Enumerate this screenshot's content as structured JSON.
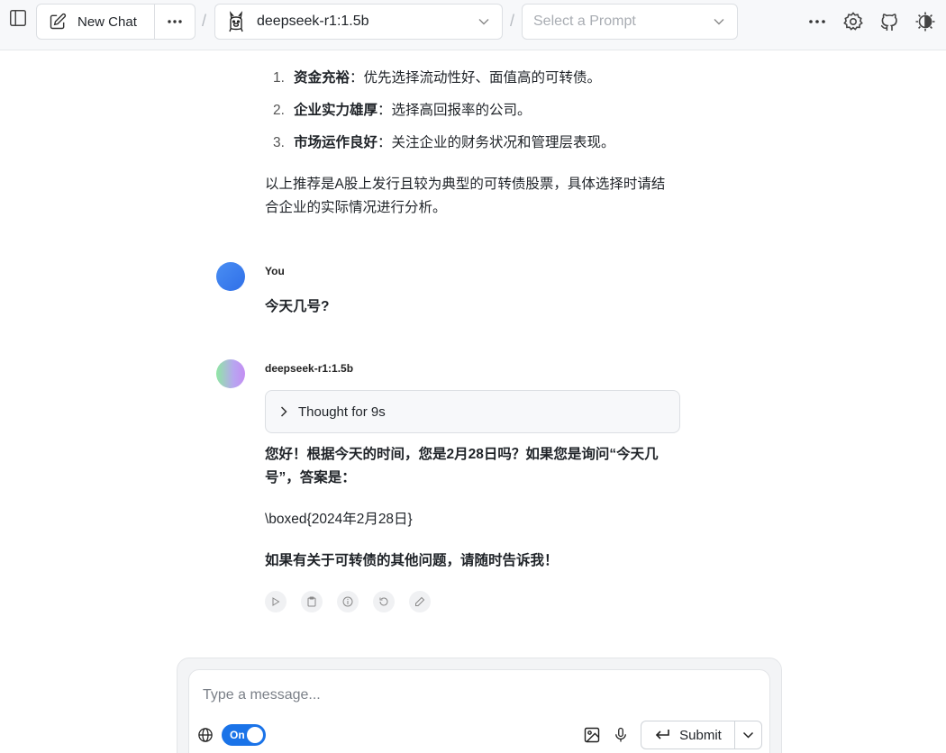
{
  "header": {
    "new_chat_label": "New Chat",
    "separator": "/",
    "model_name": "deepseek-r1:1.5b",
    "prompt_placeholder": "Select a Prompt"
  },
  "conversation": {
    "assistant_prev": {
      "list": [
        {
          "num": "1.",
          "bold": "资金充裕",
          "text": "：优先选择流动性好、面值高的可转债。"
        },
        {
          "num": "2.",
          "bold": "企业实力雄厚",
          "text": "：选择高回报率的公司。"
        },
        {
          "num": "3.",
          "bold": "市场运作良好",
          "text": "：关注企业的财务状况和管理层表现。"
        }
      ],
      "summary_line1": "以上推荐是A股上发行且较为典型的可转债股票，具体选择时请结",
      "summary_line2": "合企业的实际情况进行分析。"
    },
    "user": {
      "name": "You",
      "message": "今天几号?"
    },
    "assistant": {
      "name": "deepseek-r1:1.5b",
      "thought_label": "Thought for 9s",
      "para1_line1": "您好！根据今天的时间，您是2月28日吗？如果您是询问“今天几",
      "para1_line2": "号”，答案是：",
      "para2": "\\boxed{2024年2月28日}",
      "para3": "如果有关于可转债的其他问题，请随时告诉我！"
    }
  },
  "composer": {
    "placeholder": "Type a message...",
    "web_toggle_label": "On",
    "submit_label": "Submit"
  },
  "colors": {
    "accent": "#1a73e8",
    "topbar_bg": "#f7f8fa"
  }
}
